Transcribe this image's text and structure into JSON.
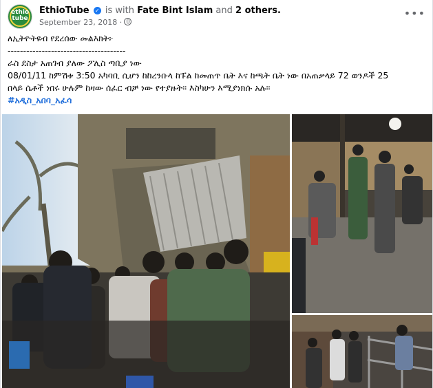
{
  "post": {
    "page_name": "EthioTube",
    "with_text": "is with",
    "tagged_person": "Fate Bint Islam",
    "and_text": "and",
    "others": "2 others.",
    "date": "September 23, 2018 ·",
    "avatar_text": "ethio tube",
    "more_icon": "more-horizontal-icon",
    "lines": [
      "ለኢትዮትዩብ የደረሰው መልእክት፦",
      "--------------------------------------",
      "ራስ ደስታ አጠገብ ያለው ፖሊስ ጣቢያ ነው",
      "08/01/11 ከምሽቱ 3:50 አካባቢ ሲሆን ከከረንቡላ ከፑል ከመጠጥ ቤት እና ከጫት ቤት ነው በአጠቃላይ 72 ወንዶች 25",
      "በላይ ሴቶች ነበሩ ሁሉም ከዛው ሰፈር ብቻ ነው የተያዙት። እስካሁን እሚያነክሱ አሉ።"
    ],
    "hashtag": "#አዲስ_አበባ_አፈሳ"
  },
  "colors": {
    "link": "#216fdb",
    "verified": "#1877f2",
    "muted": "#65676b"
  }
}
